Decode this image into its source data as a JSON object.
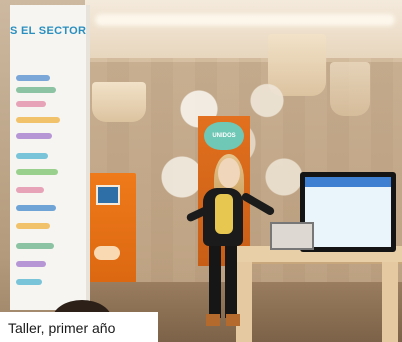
{
  "poster": {
    "title": "S EL SECTOR SH"
  },
  "booth_badge": "UNIDOS",
  "caption": "Taller, primer año"
}
